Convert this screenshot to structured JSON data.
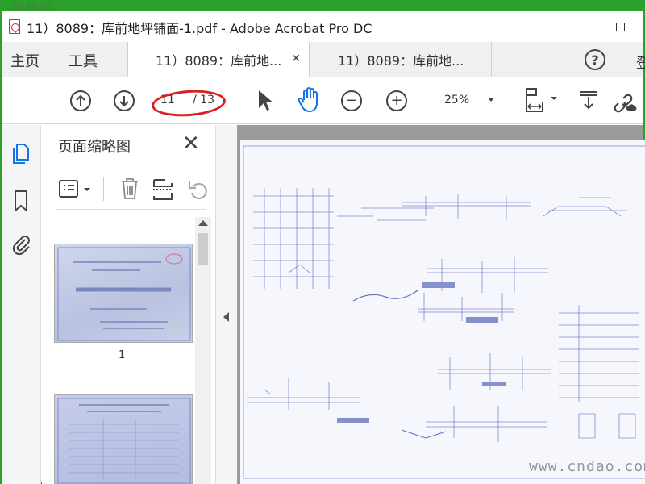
{
  "watermark_top": "道桥网",
  "window": {
    "title": "11）8089：库前地坪铺面-1.pdf - Adobe Acrobat Pro DC",
    "minimize": "—",
    "maximize": "□"
  },
  "tabs": {
    "home": "主页",
    "tools": "工具",
    "doc_tabs": [
      {
        "label": "11）8089：库前地...",
        "close": "✕"
      },
      {
        "label": "11）8089：库前地..."
      }
    ],
    "help": "?",
    "login": "登"
  },
  "toolbar": {
    "prev_page_icon": "arrow-up-circle",
    "next_page_icon": "arrow-down-circle",
    "current_page": "11",
    "total_pages": "/ 13",
    "zoom_out": "−",
    "zoom_in": "+",
    "zoom": "25%"
  },
  "panel": {
    "title": "页面缩略图",
    "close": "✕",
    "thumbnails": [
      {
        "label": "1"
      }
    ]
  },
  "watermark_bottom": "www.cndao.com",
  "colors": {
    "frame": "#2aa12a",
    "annotation": "#d82020",
    "accent_blue": "#1473e6"
  }
}
